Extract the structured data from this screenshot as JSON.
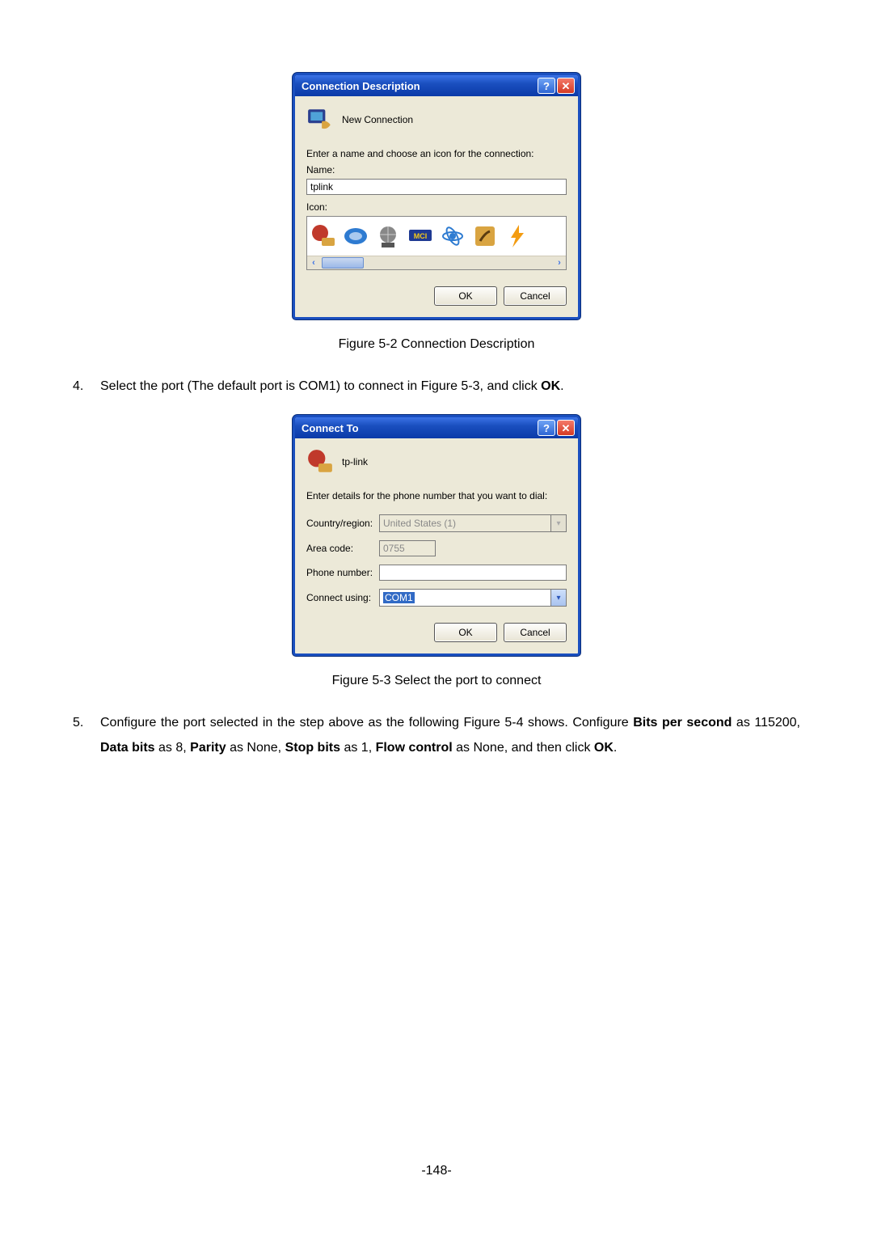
{
  "dialog1": {
    "title": "Connection Description",
    "subtitle": "New Connection",
    "instruction": "Enter a name and choose an icon for the connection:",
    "name_label": "Name:",
    "name_value": "tplink",
    "icon_label": "Icon:",
    "icons": [
      "phone-red-icon",
      "phone-blue-icon",
      "globe-modem-icon",
      "mci-icon",
      "atom-icon",
      "satellite-icon",
      "lightning-icon"
    ],
    "ok_label": "OK",
    "cancel_label": "Cancel"
  },
  "caption1": "Figure 5-2 Connection Description",
  "step4": {
    "num": "4.",
    "text_before": "Select the port (The default port is COM1) to connect in Figure 5-3, and click ",
    "bold": "OK",
    "text_after": "."
  },
  "dialog2": {
    "title": "Connect To",
    "conn_name": "tp-link",
    "instruction": "Enter details for the phone number that you want to dial:",
    "country_label": "Country/region:",
    "country_value": "United States (1)",
    "area_label": "Area code:",
    "area_value": "0755",
    "phone_label": "Phone number:",
    "phone_value": "",
    "using_label": "Connect using:",
    "using_value": "COM1",
    "ok_label": "OK",
    "cancel_label": "Cancel"
  },
  "caption2": "Figure 5-3 Select the port to connect",
  "step5": {
    "num": "5.",
    "p1a": "Configure the port selected in the step above as the following Figure 5-4 shows. Configure ",
    "b1": "Bits per second",
    "p1b": " as 115200, ",
    "b2": "Data bits",
    "p1c": " as 8, ",
    "b3": "Parity",
    "p1d": " as None, ",
    "b4": "Stop bits",
    "p1e": " as 1, ",
    "b5": "Flow control",
    "p1f": " as None, and then click ",
    "b6": "OK",
    "p1g": "."
  },
  "page_number": "-148-"
}
